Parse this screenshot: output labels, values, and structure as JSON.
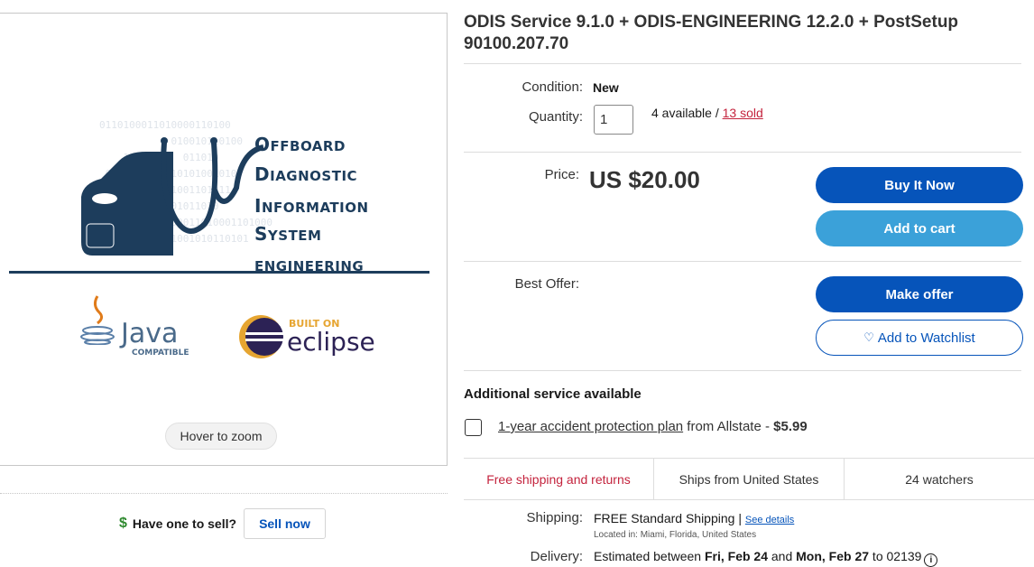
{
  "listing": {
    "title": "ODIS Service 9.1.0 + ODIS-ENGINEERING 12.2.0 + PostSetup 90100.207.70",
    "condition_label": "Condition:",
    "condition_value": "New",
    "quantity_label": "Quantity:",
    "quantity_value": "1",
    "available_text": "4 available / ",
    "sold_text": "13 sold",
    "price_label": "Price:",
    "price": "US $20.00",
    "best_offer_label": "Best Offer:"
  },
  "buttons": {
    "buy_now": "Buy It Now",
    "add_to_cart": "Add to cart",
    "make_offer": "Make offer",
    "watchlist": "Add to Watchlist"
  },
  "image_panel": {
    "hover_zoom": "Hover to zoom",
    "logo_words": [
      {
        "first": "O",
        "rest": "FFBOARD"
      },
      {
        "first": "D",
        "rest": "IAGNOSTIC"
      },
      {
        "first": "I",
        "rest": "NFORMATION"
      },
      {
        "first": "S",
        "rest": "YSTEM"
      },
      {
        "first": "",
        "rest": "ENGINEERING"
      }
    ],
    "java_label": "Java",
    "java_sub": "COMPATIBLE",
    "eclipse_built": "BUILT ON",
    "eclipse_label": "eclipse"
  },
  "sell": {
    "prompt": "Have one to sell?",
    "button": "Sell now"
  },
  "additional_service": {
    "heading": "Additional service available",
    "plan_link": "1-year accident protection plan",
    "plan_from": " from Allstate - ",
    "plan_price": "$5.99"
  },
  "shipping_bar": {
    "free_returns": "Free shipping and returns",
    "ships_from": "Ships from United States",
    "watchers": "24 watchers"
  },
  "shipping": {
    "label": "Shipping:",
    "free": "FREE",
    "method": " Standard Shipping | ",
    "see_details": "See details",
    "located": "Located in: Miami, Florida, United States"
  },
  "delivery": {
    "label": "Delivery:",
    "prefix": "Estimated between ",
    "start": "Fri, Feb 24",
    "middle": " and ",
    "end": "Mon, Feb 27",
    "suffix": " to 02139"
  },
  "colors": {
    "primary": "#0654ba",
    "secondary": "#3ba1d9",
    "sold_red": "#c4233d",
    "logo_navy": "#1d3d5c"
  },
  "icons": [
    "dollar-icon",
    "heart-icon",
    "info-icon",
    "stethoscope-car-icon",
    "java-cup-icon",
    "eclipse-icon"
  ]
}
